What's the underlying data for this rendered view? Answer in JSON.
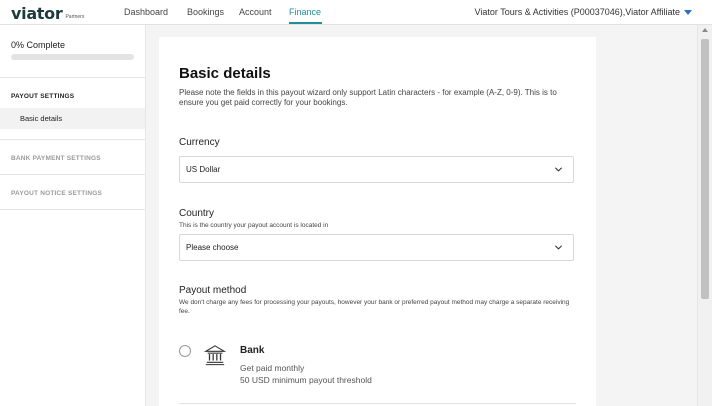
{
  "brand": {
    "name": "viator",
    "sub": "Partners",
    "accent": "#218f9a"
  },
  "nav": {
    "items": [
      {
        "label": "Dashboard"
      },
      {
        "label": "Bookings"
      },
      {
        "label": "Account"
      },
      {
        "label": "Finance",
        "active": true
      }
    ],
    "account_label": "Viator Tours & Activities (P00037046),Viator Affiliate"
  },
  "sidebar": {
    "progress_label": "0% Complete",
    "progress_value": 0,
    "sections": [
      {
        "label": "PAYOUT SETTINGS",
        "color": "#222222",
        "items": [
          {
            "label": "Basic details",
            "active": true
          }
        ]
      },
      {
        "label": "BANK PAYMENT SETTINGS",
        "color": "#9a9a9a"
      },
      {
        "label": "PAYOUT NOTICE SETTINGS",
        "color": "#9a9a9a"
      }
    ]
  },
  "form": {
    "title": "Basic details",
    "intro": "Please note the fields in this payout wizard only support Latin characters - for example (A-Z, 0-9). This is to ensure you get paid correctly for your bookings.",
    "currency": {
      "label": "Currency",
      "value": "US Dollar"
    },
    "country": {
      "label": "Country",
      "hint": "This is the country your payout account is located in",
      "placeholder": "Please choose"
    },
    "payout_method": {
      "label": "Payout method",
      "hint": "We don't charge any fees for processing your payouts, however your bank or preferred payout method may charge a separate receiving fee.",
      "options": [
        {
          "icon": "bank-icon",
          "title": "Bank",
          "line1": "Get paid monthly",
          "line2": "50 USD minimum payout threshold",
          "selected": false
        }
      ]
    }
  }
}
